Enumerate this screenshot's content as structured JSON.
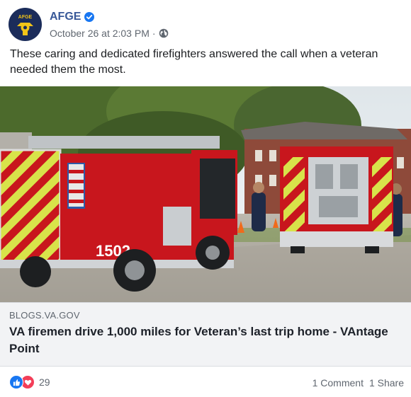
{
  "post": {
    "page_name": "AFGE",
    "timestamp": "October 26 at 2:03 PM",
    "separator": "·",
    "avatar_label": "AFGE",
    "text": "These caring and dedicated firefighters answered the call when a veteran needed them the most.",
    "photo": {
      "truck_number": "1502",
      "description_icon": "fire-truck-photo"
    }
  },
  "link_preview": {
    "domain": "BLOGS.VA.GOV",
    "title": "VA firemen drive 1,000 miles for Veteran’s last trip home - VAntage Point"
  },
  "footer": {
    "reaction_count": "29",
    "comments": "1 Comment",
    "shares": "1 Share"
  },
  "colors": {
    "brand_blue": "#385898",
    "avatar_bg": "#1b2c5a",
    "like_blue": "#1877f2",
    "love_red": "#f33e58",
    "truck_red": "#c8161d"
  }
}
